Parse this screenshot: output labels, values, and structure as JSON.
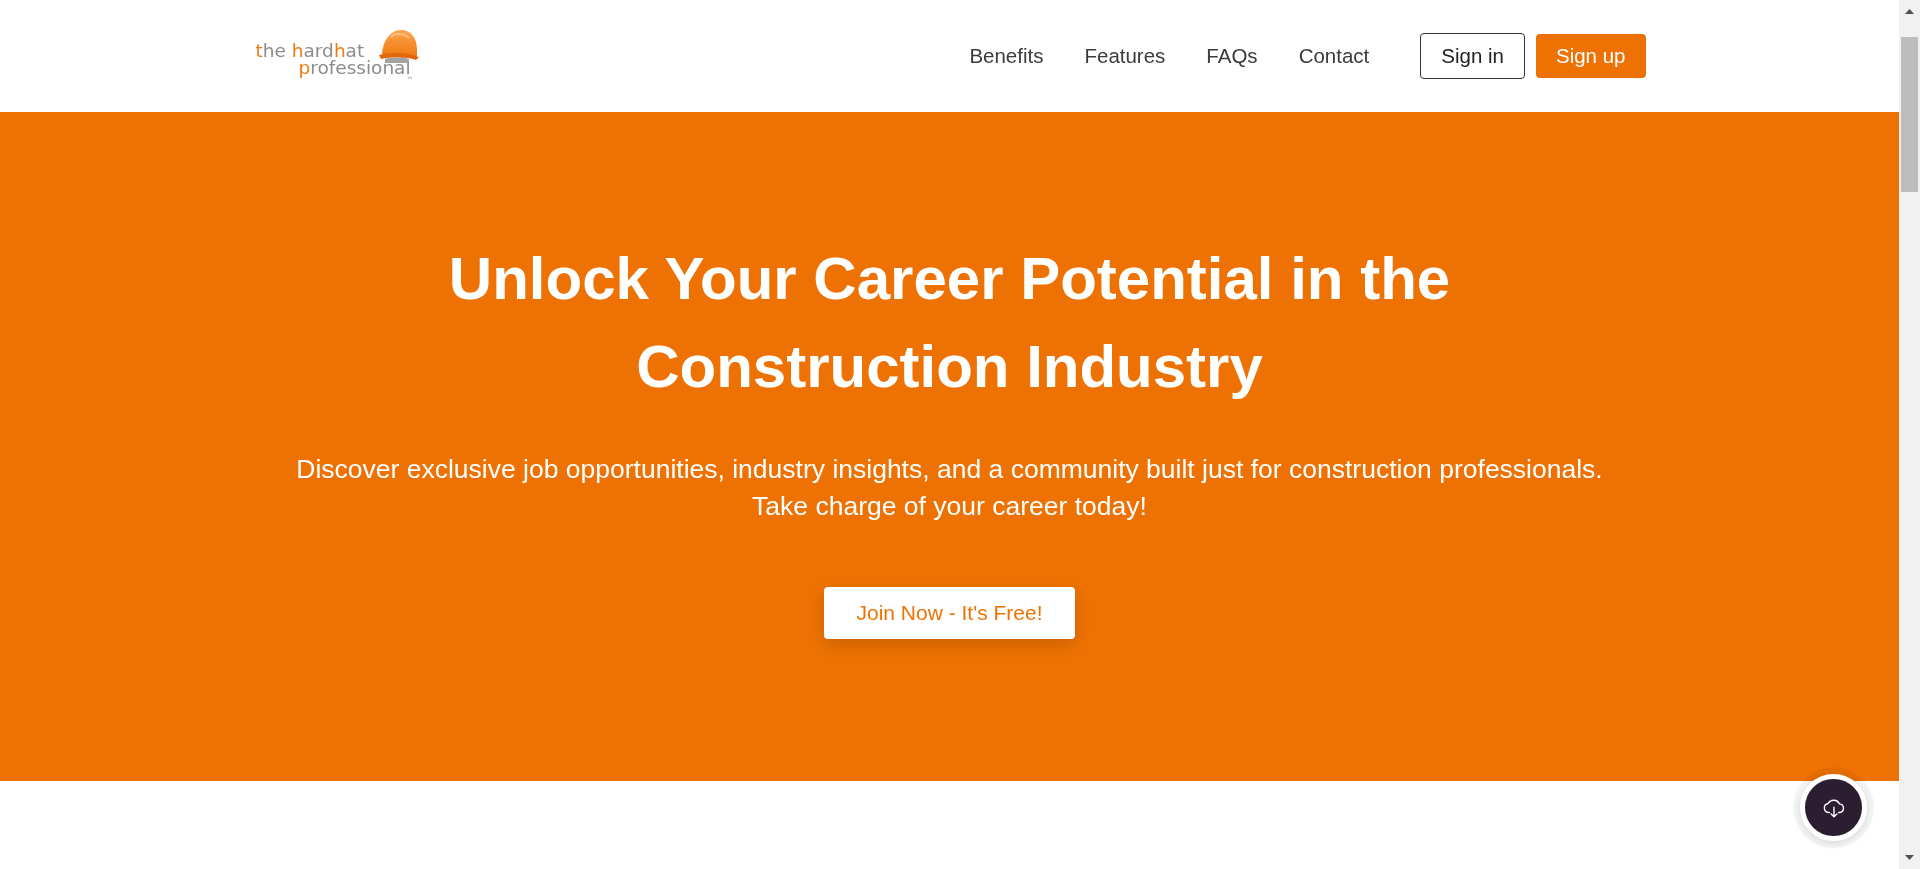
{
  "logo": {
    "lines": [
      [
        {
          "text": "t",
          "accent": true
        },
        {
          "text": "he ",
          "accent": false
        },
        {
          "text": "h",
          "accent": true
        },
        {
          "text": "ard",
          "accent": false
        },
        {
          "text": "h",
          "accent": true
        },
        {
          "text": "at",
          "accent": false
        }
      ],
      [
        {
          "text": "p",
          "accent": true
        },
        {
          "text": "rofessional",
          "accent": false
        }
      ]
    ],
    "trademark": "™"
  },
  "nav": {
    "links": [
      "Benefits",
      "Features",
      "FAQs",
      "Contact"
    ],
    "buttons": [
      {
        "label": "Sign in",
        "kind": "outline"
      },
      {
        "label": "Sign up",
        "kind": "filled"
      }
    ]
  },
  "hero": {
    "title": "Unlock Your Career Potential in the Construction Industry",
    "subtitle": "Discover exclusive job opportunities, industry insights, and a community built just for construction professionals. Take charge of your career today!",
    "cta": "Join Now - It's Free!"
  }
}
